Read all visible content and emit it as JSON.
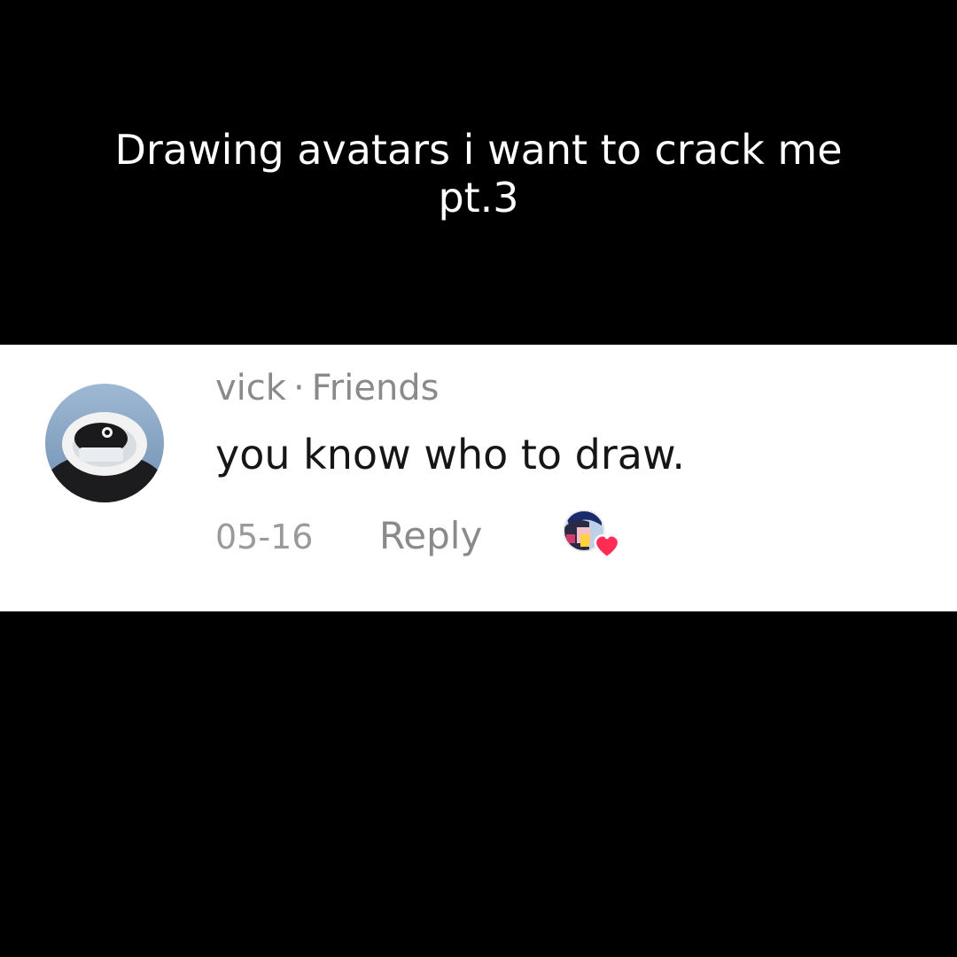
{
  "caption": {
    "line1": "Drawing avatars i want to crack me",
    "line2": "pt.3"
  },
  "comment": {
    "username": "vick",
    "separator": "·",
    "relationship": "Friends",
    "text": "you know who to draw.",
    "date": "05-16",
    "reply_label": "Reply",
    "avatar_icon": "user-avatar-icon",
    "creator_like_icon": "liked-by-creator-icon"
  },
  "colors": {
    "background": "#000000",
    "card": "#ffffff",
    "caption_text": "#ffffff",
    "comment_text": "#161616",
    "muted_text": "#8a8a8a",
    "heart": "#ff2d55"
  }
}
